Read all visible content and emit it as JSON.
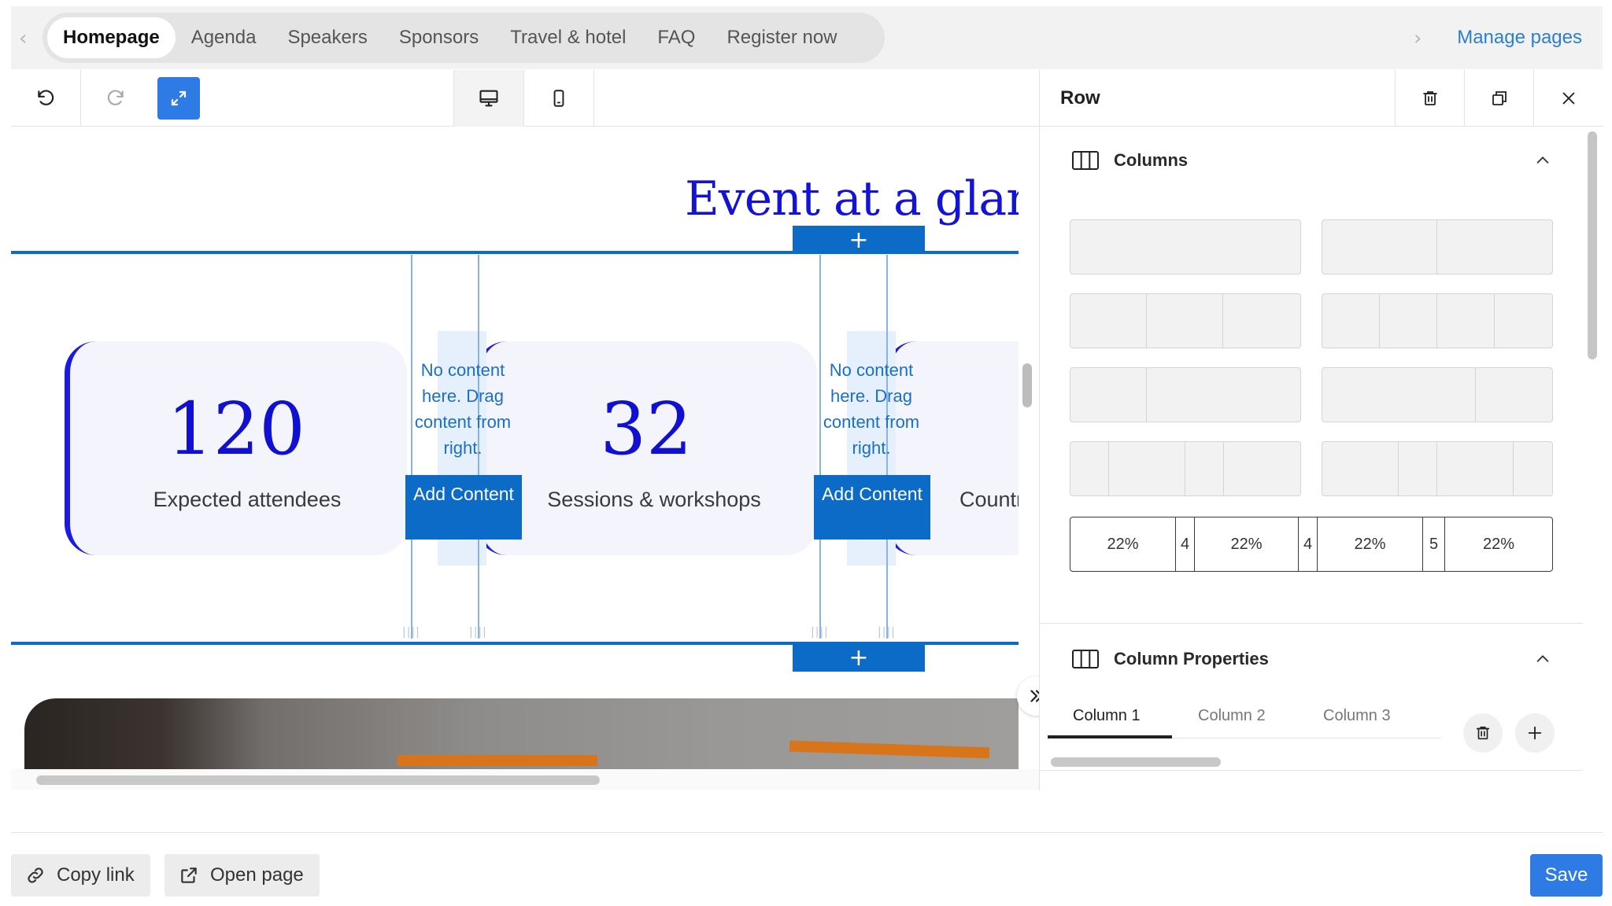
{
  "tabs": [
    "Homepage",
    "Agenda",
    "Speakers",
    "Sponsors",
    "Travel & hotel",
    "FAQ",
    "Register now"
  ],
  "manage_pages": "Manage pages",
  "canvas": {
    "title": "Event at a glance",
    "stats": [
      {
        "value": "120",
        "label": "Expected attendees"
      },
      {
        "value": "32",
        "label": "Sessions & workshops"
      },
      {
        "value": "",
        "label": "Countr"
      }
    ],
    "no_content_text": "No content here. Drag content from right.",
    "add_content_label": "Add Content",
    "plus": "+"
  },
  "panel": {
    "title": "Row",
    "columns_section": "Columns",
    "column_properties_section": "Column Properties",
    "custom_layout": [
      "22%",
      "4",
      "22%",
      "4",
      "22%",
      "5",
      "22%"
    ],
    "column_tabs": [
      "Column 1",
      "Column 2",
      "Column 3"
    ]
  },
  "footer": {
    "copy_link": "Copy link",
    "open_page": "Open page",
    "save": "Save"
  },
  "colors": {
    "accent": "#2f7be6",
    "row_blue": "#0b6bc7",
    "heading_blue": "#1212d8"
  }
}
